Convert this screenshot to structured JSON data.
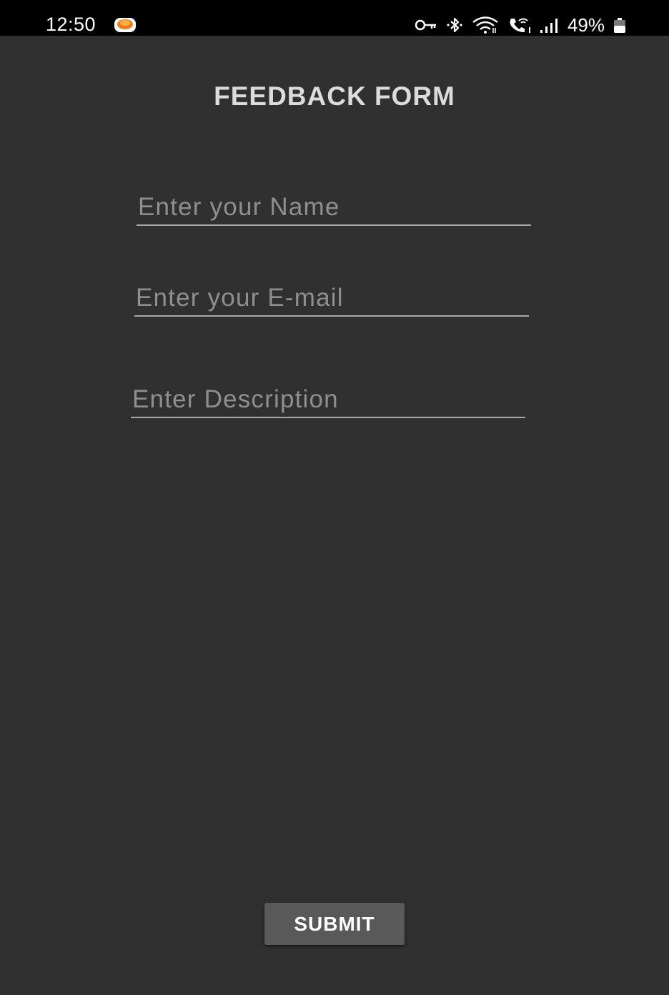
{
  "status_bar": {
    "time": "12:50",
    "battery_percent": "49%",
    "icons": [
      "app-notification-icon",
      "vpn-key-icon",
      "bluetooth-icon",
      "wifi-icon",
      "wifi-calling-icon",
      "signal-icon",
      "battery-icon"
    ]
  },
  "form": {
    "title": "FEEDBACK FORM",
    "name_placeholder": "Enter your Name",
    "name_value": "",
    "email_placeholder": "Enter your E-mail",
    "email_value": "",
    "description_placeholder": "Enter Description",
    "description_value": "",
    "submit_label": "SUBMIT"
  },
  "colors": {
    "background": "#303030",
    "status_bar": "#000000",
    "title_text": "#dcdcdc",
    "placeholder_text": "#8f8f8f",
    "underline": "#a8a8a8",
    "button_bg": "#595959",
    "button_text": "#ffffff"
  }
}
